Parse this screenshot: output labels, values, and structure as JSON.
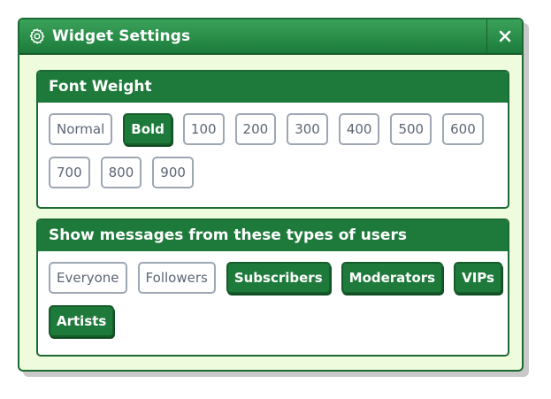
{
  "window": {
    "title": "Widget Settings",
    "title_icon": "gear-icon",
    "close_icon": "close-icon"
  },
  "font_weight": {
    "heading": "Font Weight",
    "options": [
      {
        "label": "Normal",
        "selected": false
      },
      {
        "label": "Bold",
        "selected": true
      },
      {
        "label": "100",
        "selected": false
      },
      {
        "label": "200",
        "selected": false
      },
      {
        "label": "300",
        "selected": false
      },
      {
        "label": "400",
        "selected": false
      },
      {
        "label": "500",
        "selected": false
      },
      {
        "label": "600",
        "selected": false
      },
      {
        "label": "700",
        "selected": false
      },
      {
        "label": "800",
        "selected": false
      },
      {
        "label": "900",
        "selected": false
      }
    ]
  },
  "user_types": {
    "heading": "Show messages from these types of users",
    "options": [
      {
        "label": "Everyone",
        "selected": false
      },
      {
        "label": "Followers",
        "selected": false
      },
      {
        "label": "Subscribers",
        "selected": true
      },
      {
        "label": "Moderators",
        "selected": true
      },
      {
        "label": "VIPs",
        "selected": true
      },
      {
        "label": "Artists",
        "selected": true
      }
    ]
  },
  "colors": {
    "accent": "#1e7a3b",
    "window_bg": "#eefbdc",
    "border": "#1b6a33",
    "inactive_text": "#5c6675",
    "inactive_border": "#9ea7b3"
  }
}
